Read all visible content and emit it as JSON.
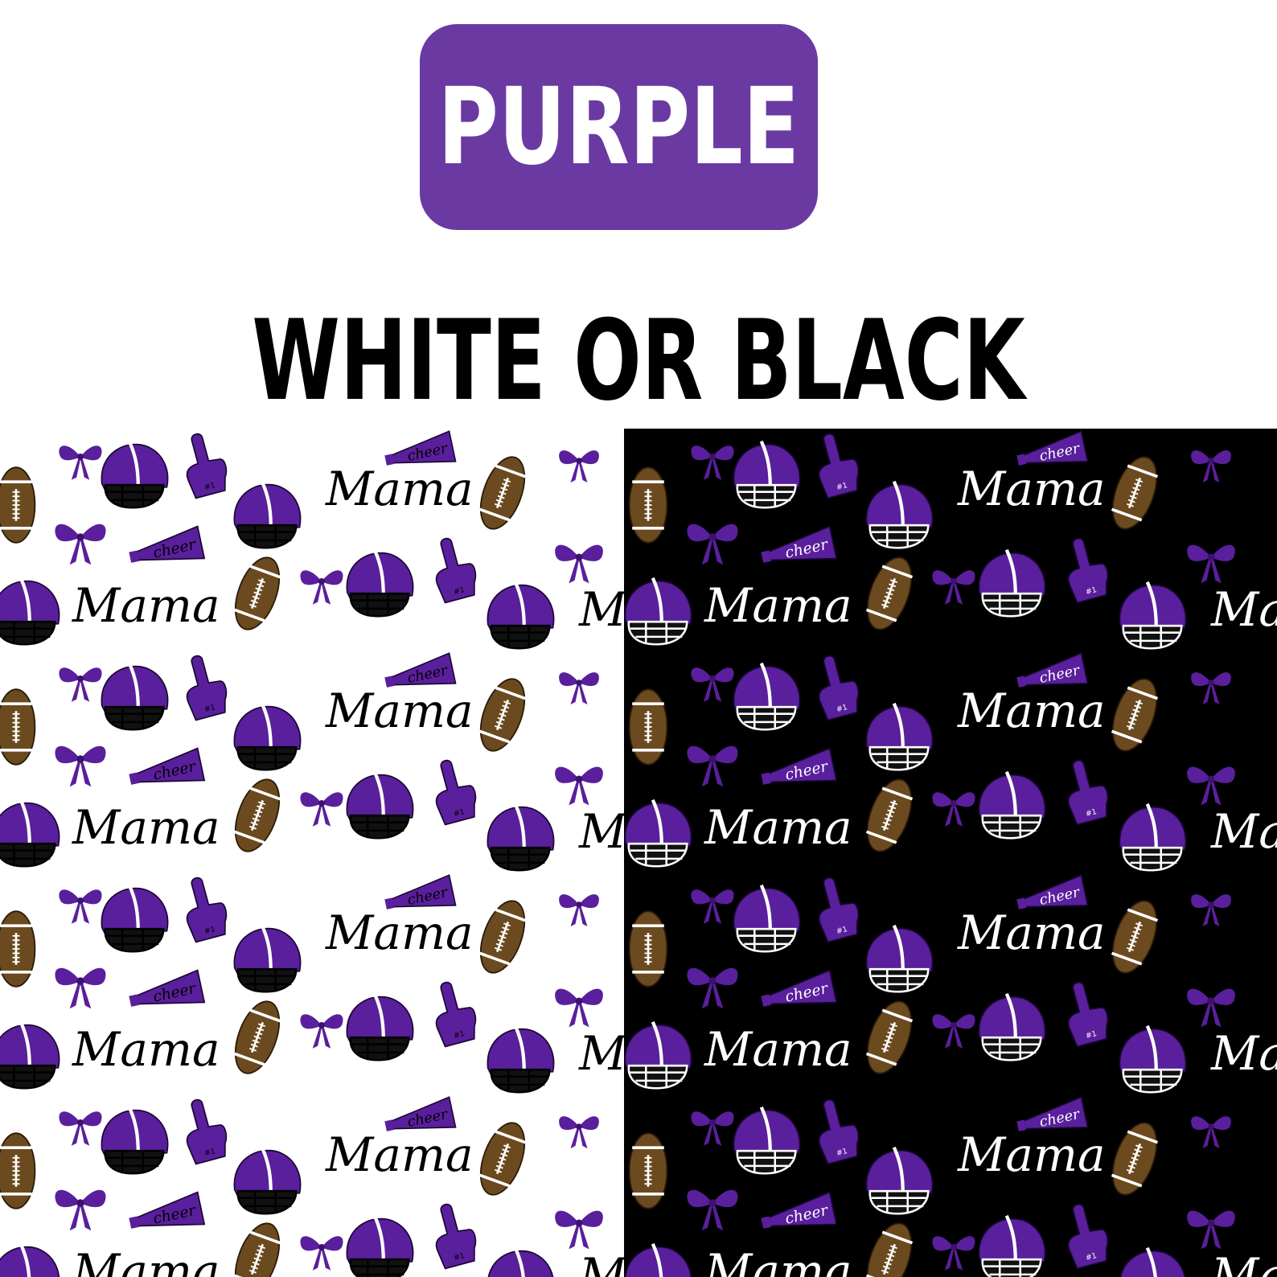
{
  "header": {
    "color_name": "PURPLE",
    "options_label": "WHITE OR BLACK"
  },
  "colors": {
    "badge_purple": "#6a3aa2",
    "print_purple": "#5a1f9c",
    "football_brown": "#6b4a1f",
    "light_background": "#ffffff",
    "dark_background": "#000000"
  },
  "pattern": {
    "word": "Mama",
    "megaphone_word": "cheer",
    "foam_finger_text": "#1",
    "motifs": [
      "helmet-icon",
      "bow-icon",
      "football-icon",
      "foam-finger-icon",
      "megaphone-icon"
    ]
  },
  "panels": [
    {
      "name": "white",
      "background": "#ffffff",
      "text_color": "#000000"
    },
    {
      "name": "black",
      "background": "#000000",
      "text_color": "#ffffff"
    }
  ]
}
